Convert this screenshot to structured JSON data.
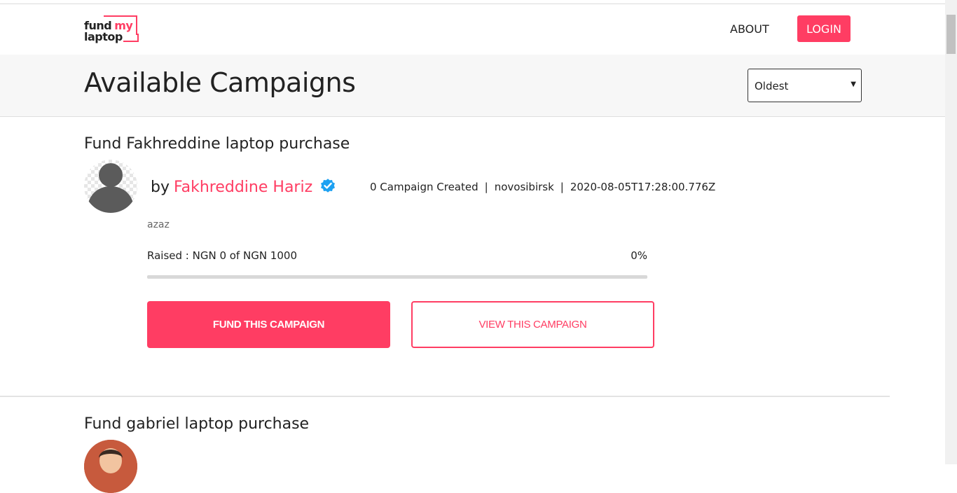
{
  "header": {
    "logo_line1": "fund",
    "logo_my": "my",
    "logo_line2": "laptop",
    "about": "ABOUT",
    "login": "LOGIN"
  },
  "page": {
    "title": "Available Campaigns",
    "sort": {
      "selected": "Oldest",
      "caret": "▾"
    }
  },
  "campaigns": [
    {
      "title": "Fund Fakhreddine laptop purchase",
      "by": "by",
      "owner": "Fakhreddine Hariz",
      "campaigns_created": "0 Campaign Created",
      "location": "novosibirsk",
      "date": "2020-08-05T17:28:00.776Z",
      "description": "azaz",
      "raised": "Raised : NGN 0 of NGN 1000",
      "percent": "0%",
      "progress": 0,
      "fund_button": "FUND THIS CAMPAIGN",
      "view_button": "VIEW THIS CAMPAIGN",
      "avatar_icon": "user-silhouette-icon"
    },
    {
      "title": "Fund gabriel laptop purchase",
      "avatar_icon": "user-photo"
    }
  ],
  "colors": {
    "accent": "#ff3d63",
    "verified": "#1da1f2",
    "band": "#f7f7f7"
  }
}
